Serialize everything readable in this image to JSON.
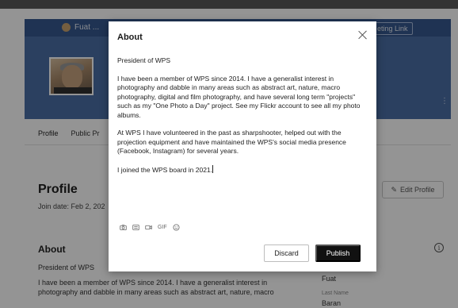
{
  "background": {
    "site_user": "Fuat ...",
    "meeting_link": "eting Link",
    "cover_menu": "⋮",
    "tabs": [
      "Profile",
      "Public Pr"
    ],
    "profile_title": "Profile",
    "join_date": "Join date: Feb 2, 202",
    "edit_profile_label": "Edit Profile",
    "about_title": "About",
    "about_role": "President of WPS",
    "about_bio": "I have been a member of WPS since 2014.  I have a generalist interest in photography and dabble in many areas such as abstract art, nature, macro",
    "first_name_label": "",
    "first_name_value": "Fuat",
    "last_name_label": "Last Name",
    "last_name_value": "Baran"
  },
  "modal": {
    "title": "About",
    "paragraphs": [
      "President of WPS",
      "I have been a member of WPS since 2014.  I have a generalist interest in photography and dabble in many areas such as abstract art, nature, macro photography, digital and film photography, and have several long term \"projects\" such as my \"One Photo a Day\" project.  See my Flickr account to see all my photo albums.",
      "At WPS I have volunteered in the past as sharpshooter, helped out with the projection equipment and have maintained the WPS's social media presence (Facebook, Instagram) for several years.",
      "I joined the WPS board in 2021."
    ],
    "toolbar": {
      "camera_icon": "camera-icon",
      "list_icon": "list-icon",
      "video_icon": "video-icon",
      "gif_label": "GIF",
      "emoji_icon": "emoji-icon"
    },
    "discard_label": "Discard",
    "publish_label": "Publish"
  },
  "colors": {
    "cover": "#4a6ea6",
    "primary_button": "#111111",
    "overlay": "rgba(0,0,0,0.42)"
  }
}
